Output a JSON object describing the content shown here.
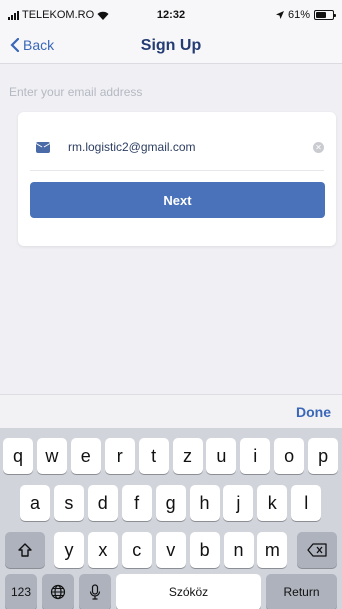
{
  "status_bar": {
    "carrier": "TELEKOM.RO",
    "time": "12:32",
    "battery": "61%",
    "battery_level": 0.61
  },
  "nav": {
    "back_label": "Back",
    "title": "Sign Up"
  },
  "form": {
    "prompt": "Enter your email address",
    "email_value": "rm.logistic2@gmail.com",
    "next_label": "Next"
  },
  "keyboard": {
    "done_label": "Done",
    "row1": [
      "q",
      "w",
      "e",
      "r",
      "t",
      "z",
      "u",
      "i",
      "o",
      "p"
    ],
    "row2": [
      "a",
      "s",
      "d",
      "f",
      "g",
      "h",
      "j",
      "k",
      "l"
    ],
    "row3": [
      "y",
      "x",
      "c",
      "v",
      "b",
      "n",
      "m"
    ],
    "numbers_label": "123",
    "space_label": "Szóköz",
    "return_label": "Return"
  }
}
